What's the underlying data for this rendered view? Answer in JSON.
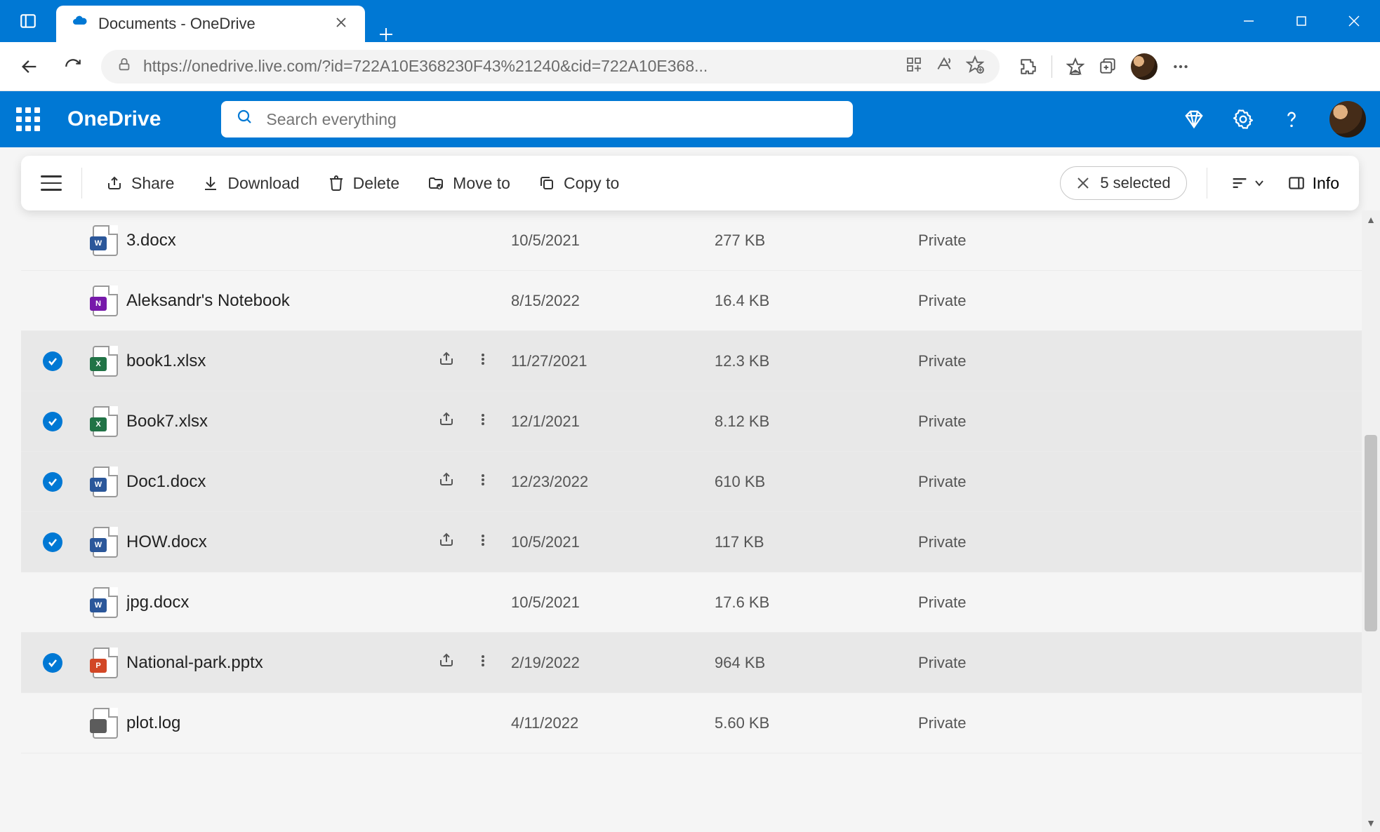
{
  "browser": {
    "tab_title": "Documents - OneDrive",
    "url": "https://onedrive.live.com/?id=722A10E368230F43%21240&cid=722A10E368..."
  },
  "header": {
    "brand": "OneDrive",
    "search_placeholder": "Search everything"
  },
  "commandbar": {
    "share": "Share",
    "download": "Download",
    "delete": "Delete",
    "move_to": "Move to",
    "copy_to": "Copy to",
    "selected_text": "5 selected",
    "info": "Info"
  },
  "columns": {
    "sharing_default": "Private"
  },
  "files": [
    {
      "name": "3.docx",
      "modified": "10/5/2021",
      "size": "277 KB",
      "sharing": "Private",
      "type": "word",
      "badge": "W",
      "selected": false
    },
    {
      "name": "Aleksandr's Notebook",
      "modified": "8/15/2022",
      "size": "16.4 KB",
      "sharing": "Private",
      "type": "onenote",
      "badge": "N",
      "selected": false
    },
    {
      "name": "book1.xlsx",
      "modified": "11/27/2021",
      "size": "12.3 KB",
      "sharing": "Private",
      "type": "excel",
      "badge": "X",
      "selected": true
    },
    {
      "name": "Book7.xlsx",
      "modified": "12/1/2021",
      "size": "8.12 KB",
      "sharing": "Private",
      "type": "excel",
      "badge": "X",
      "selected": true
    },
    {
      "name": "Doc1.docx",
      "modified": "12/23/2022",
      "size": "610 KB",
      "sharing": "Private",
      "type": "word",
      "badge": "W",
      "selected": true
    },
    {
      "name": "HOW.docx",
      "modified": "10/5/2021",
      "size": "117 KB",
      "sharing": "Private",
      "type": "word",
      "badge": "W",
      "selected": true
    },
    {
      "name": "jpg.docx",
      "modified": "10/5/2021",
      "size": "17.6 KB",
      "sharing": "Private",
      "type": "word",
      "badge": "W",
      "selected": false
    },
    {
      "name": "National-park.pptx",
      "modified": "2/19/2022",
      "size": "964 KB",
      "sharing": "Private",
      "type": "ppt",
      "badge": "P",
      "selected": true
    },
    {
      "name": "plot.log",
      "modified": "4/11/2022",
      "size": "5.60 KB",
      "sharing": "Private",
      "type": "code",
      "badge": "</>",
      "selected": false
    }
  ]
}
